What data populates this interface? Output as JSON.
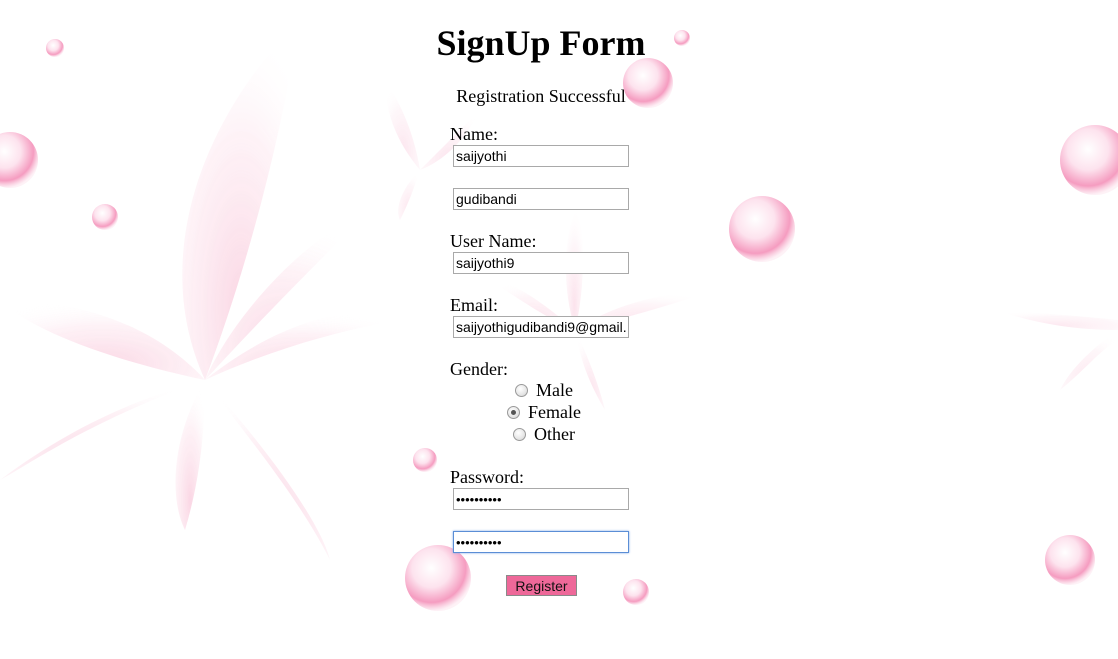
{
  "page": {
    "title": "SignUp Form",
    "status_message": "Registration Successful"
  },
  "form": {
    "name_label": "Name:",
    "first_name_value": "saijyothi",
    "last_name_value": "gudibandi",
    "username_label": "User Name:",
    "username_value": "saijyothi9",
    "email_label": "Email:",
    "email_value": "saijyothigudibandi9@gmail.",
    "gender_label": "Gender:",
    "gender_options": [
      {
        "label": "Male",
        "checked": false
      },
      {
        "label": "Female",
        "checked": true
      },
      {
        "label": "Other",
        "checked": false
      }
    ],
    "password_label": "Password:",
    "password_value": "••••••••••",
    "confirm_password_value": "••••••••••",
    "register_label": "Register"
  },
  "colors": {
    "background": "#ffffff",
    "petal_pink": "#f7b9cf",
    "pearl_pink": "#f48bb5",
    "register_button": "#ee6899",
    "focus_border": "#5b8ed6"
  }
}
